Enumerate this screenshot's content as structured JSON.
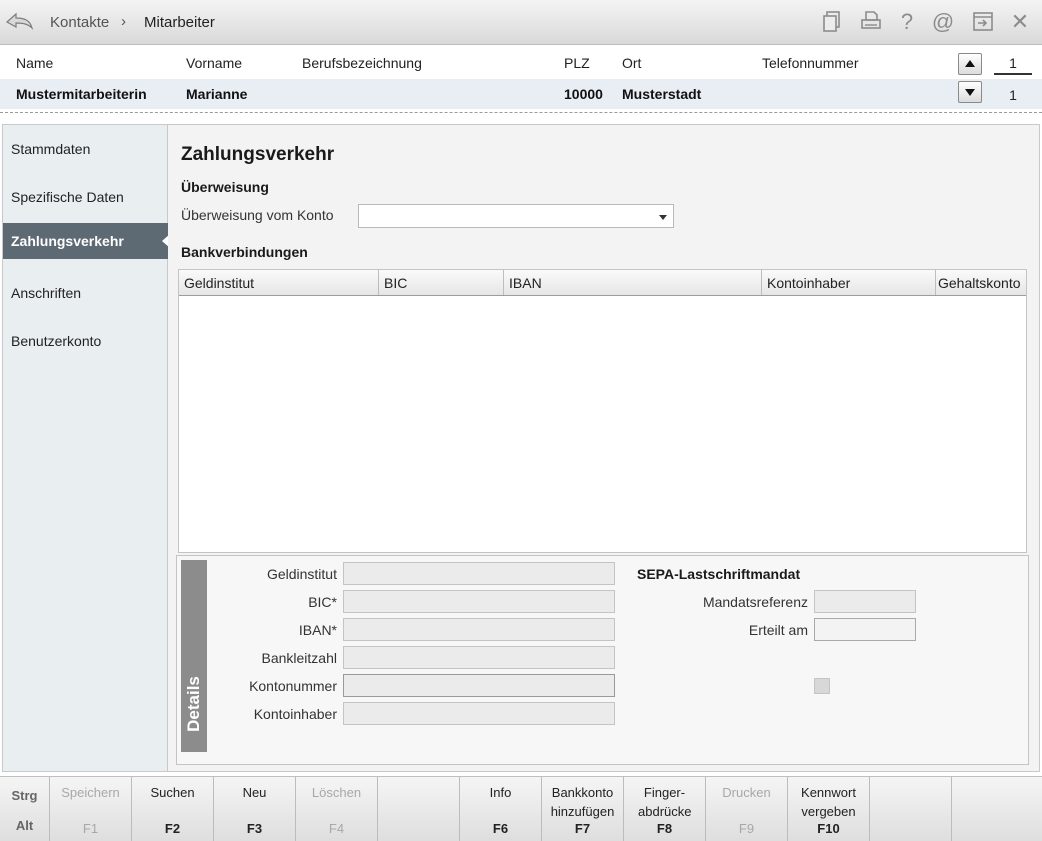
{
  "header": {
    "breadcrumb": [
      "Kontakte",
      "Mitarbeiter"
    ],
    "breadcrumb_sep": "›",
    "icons": [
      "documents-icon",
      "printer-icon",
      "help-icon",
      "email-icon",
      "export-icon",
      "close-icon"
    ]
  },
  "person": {
    "columns": {
      "name": "Name",
      "vorname": "Vorname",
      "beruf": "Berufsbezeichnung",
      "plz": "PLZ",
      "ort": "Ort",
      "telefon": "Telefonnummer"
    },
    "row": {
      "name": "Mustermitarbeiterin",
      "vorname": "Marianne",
      "beruf": "",
      "plz": "10000",
      "ort": "Musterstadt",
      "telefon": ""
    },
    "counter_top": "1",
    "counter_bottom": "1"
  },
  "sidebar": {
    "items": [
      {
        "label": "Stammdaten",
        "active": false
      },
      {
        "label": "Spezifische Daten",
        "active": false
      },
      {
        "label": "Zahlungsverkehr",
        "active": true
      },
      {
        "label": "Anschriften",
        "active": false
      },
      {
        "label": "Benutzerkonto",
        "active": false
      }
    ]
  },
  "main": {
    "title": "Zahlungsverkehr",
    "transfer_section": "Überweisung",
    "transfer_label": "Überweisung vom Konto",
    "transfer_value": "",
    "bank_section": "Bankverbindungen",
    "grid_columns": [
      "Geldinstitut",
      "BIC",
      "IBAN",
      "Kontoinhaber",
      "Gehaltskonto"
    ],
    "grid_rows": []
  },
  "details": {
    "tab_label": "Details",
    "fields": [
      {
        "label": "Geldinstitut",
        "value": ""
      },
      {
        "label": "BIC*",
        "value": ""
      },
      {
        "label": "IBAN*",
        "value": ""
      },
      {
        "label": "Bankleitzahl",
        "value": ""
      },
      {
        "label": "Kontonummer",
        "value": ""
      },
      {
        "label": "Kontoinhaber",
        "value": ""
      }
    ],
    "sepa_title": "SEPA-Lastschriftmandat",
    "mandat_label": "Mandatsreferenz",
    "mandat_value": "",
    "erteilt_label": "Erteilt am",
    "erteilt_value": ""
  },
  "fkeys": {
    "mod_top": "Strg",
    "mod_bottom": "Alt",
    "keys": [
      {
        "label": "Speichern",
        "key": "F1",
        "enabled": false
      },
      {
        "label": "Suchen",
        "key": "F2",
        "enabled": true
      },
      {
        "label": "Neu",
        "key": "F3",
        "enabled": true
      },
      {
        "label": "Löschen",
        "key": "F4",
        "enabled": false
      },
      {
        "label": "",
        "key": "",
        "enabled": false
      },
      {
        "label": "Info",
        "key": "F6",
        "enabled": true
      },
      {
        "label": "Bankkonto hinzufügen",
        "key": "F7",
        "enabled": true
      },
      {
        "label": "Finger-abdrücke",
        "key": "F8",
        "enabled": true
      },
      {
        "label": "Drucken",
        "key": "F9",
        "enabled": false
      },
      {
        "label": "Kennwort vergeben",
        "key": "F10",
        "enabled": true
      },
      {
        "label": "",
        "key": "",
        "enabled": false
      },
      {
        "label": "",
        "key": "",
        "enabled": false
      }
    ]
  },
  "colors": {
    "sidebar_active": "#5e6a73",
    "header_row": "#e8eef3",
    "details_tab": "#8c8c8c"
  }
}
